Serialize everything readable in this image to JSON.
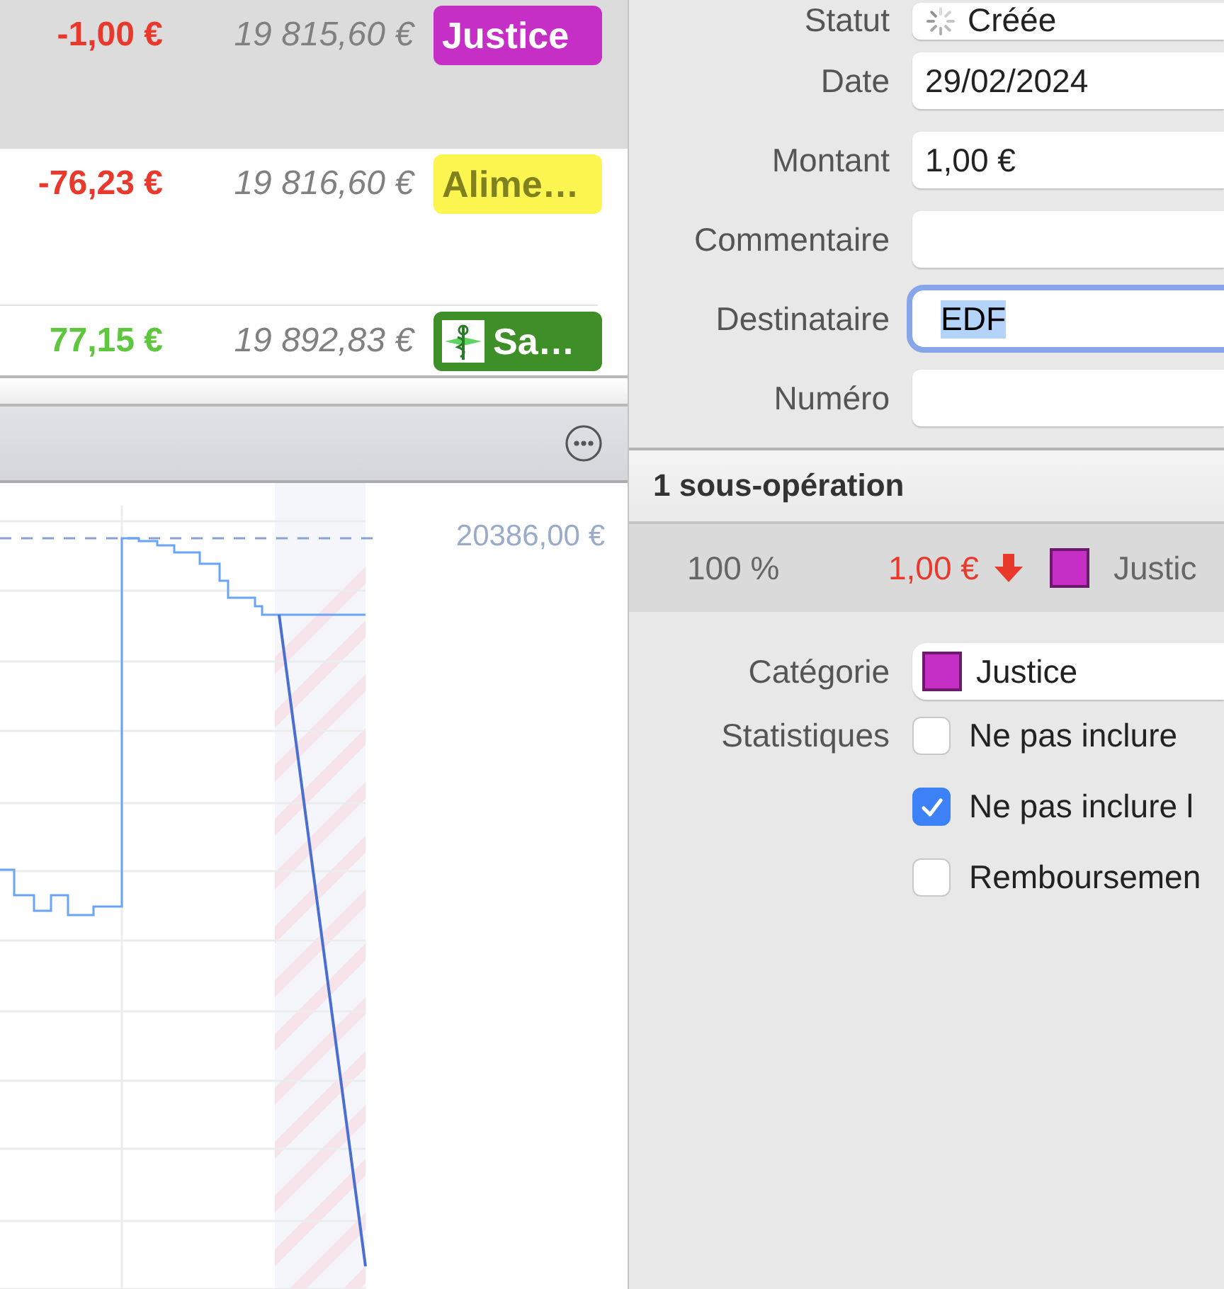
{
  "transactions": [
    {
      "amount": "-1,00 €",
      "positive": false,
      "balance": "19 815,60 €",
      "category": {
        "label": "Justice",
        "color": "#c62fc6",
        "kind": "plain"
      },
      "selected": true
    },
    {
      "amount": "-76,23 €",
      "positive": false,
      "balance": "19 816,60 €",
      "category": {
        "label": "Alime…",
        "color": "#fdf650",
        "kind": "plain"
      },
      "selected": false
    },
    {
      "amount": "77,15 €",
      "positive": true,
      "balance": "19 892,83 €",
      "category": {
        "label": "Sa…",
        "color": "#3f8f28",
        "kind": "icon"
      },
      "selected": false
    }
  ],
  "chart": {
    "max_label": "20386,00 €"
  },
  "form": {
    "status": {
      "label": "Statut",
      "value": "Créée"
    },
    "fields": [
      {
        "label": "Date",
        "value": "29/02/2024",
        "focused": false
      },
      {
        "label": "Montant",
        "value": "1,00 €",
        "focused": false
      },
      {
        "label": "Commentaire",
        "focused": false
      },
      {
        "label": "Destinataire",
        "value": "EDF",
        "focused": true
      },
      {
        "label": "Numéro",
        "focused": false
      }
    ]
  },
  "sub_operations": {
    "header": "1 sous-opération",
    "split": {
      "percent": "100 %",
      "amount": "1,00 €",
      "decrease": true,
      "category": "Justic",
      "color": "#c62fc6"
    },
    "category": {
      "label": "Catégorie",
      "value": "Justice",
      "color": "#c62fc6"
    },
    "statistics": {
      "label": "Statistiques",
      "options": [
        {
          "label": "Ne pas inclure",
          "checked": false
        },
        {
          "label": "Ne pas inclure l",
          "checked": true
        },
        {
          "label": "Remboursemen",
          "checked": false
        }
      ]
    }
  }
}
